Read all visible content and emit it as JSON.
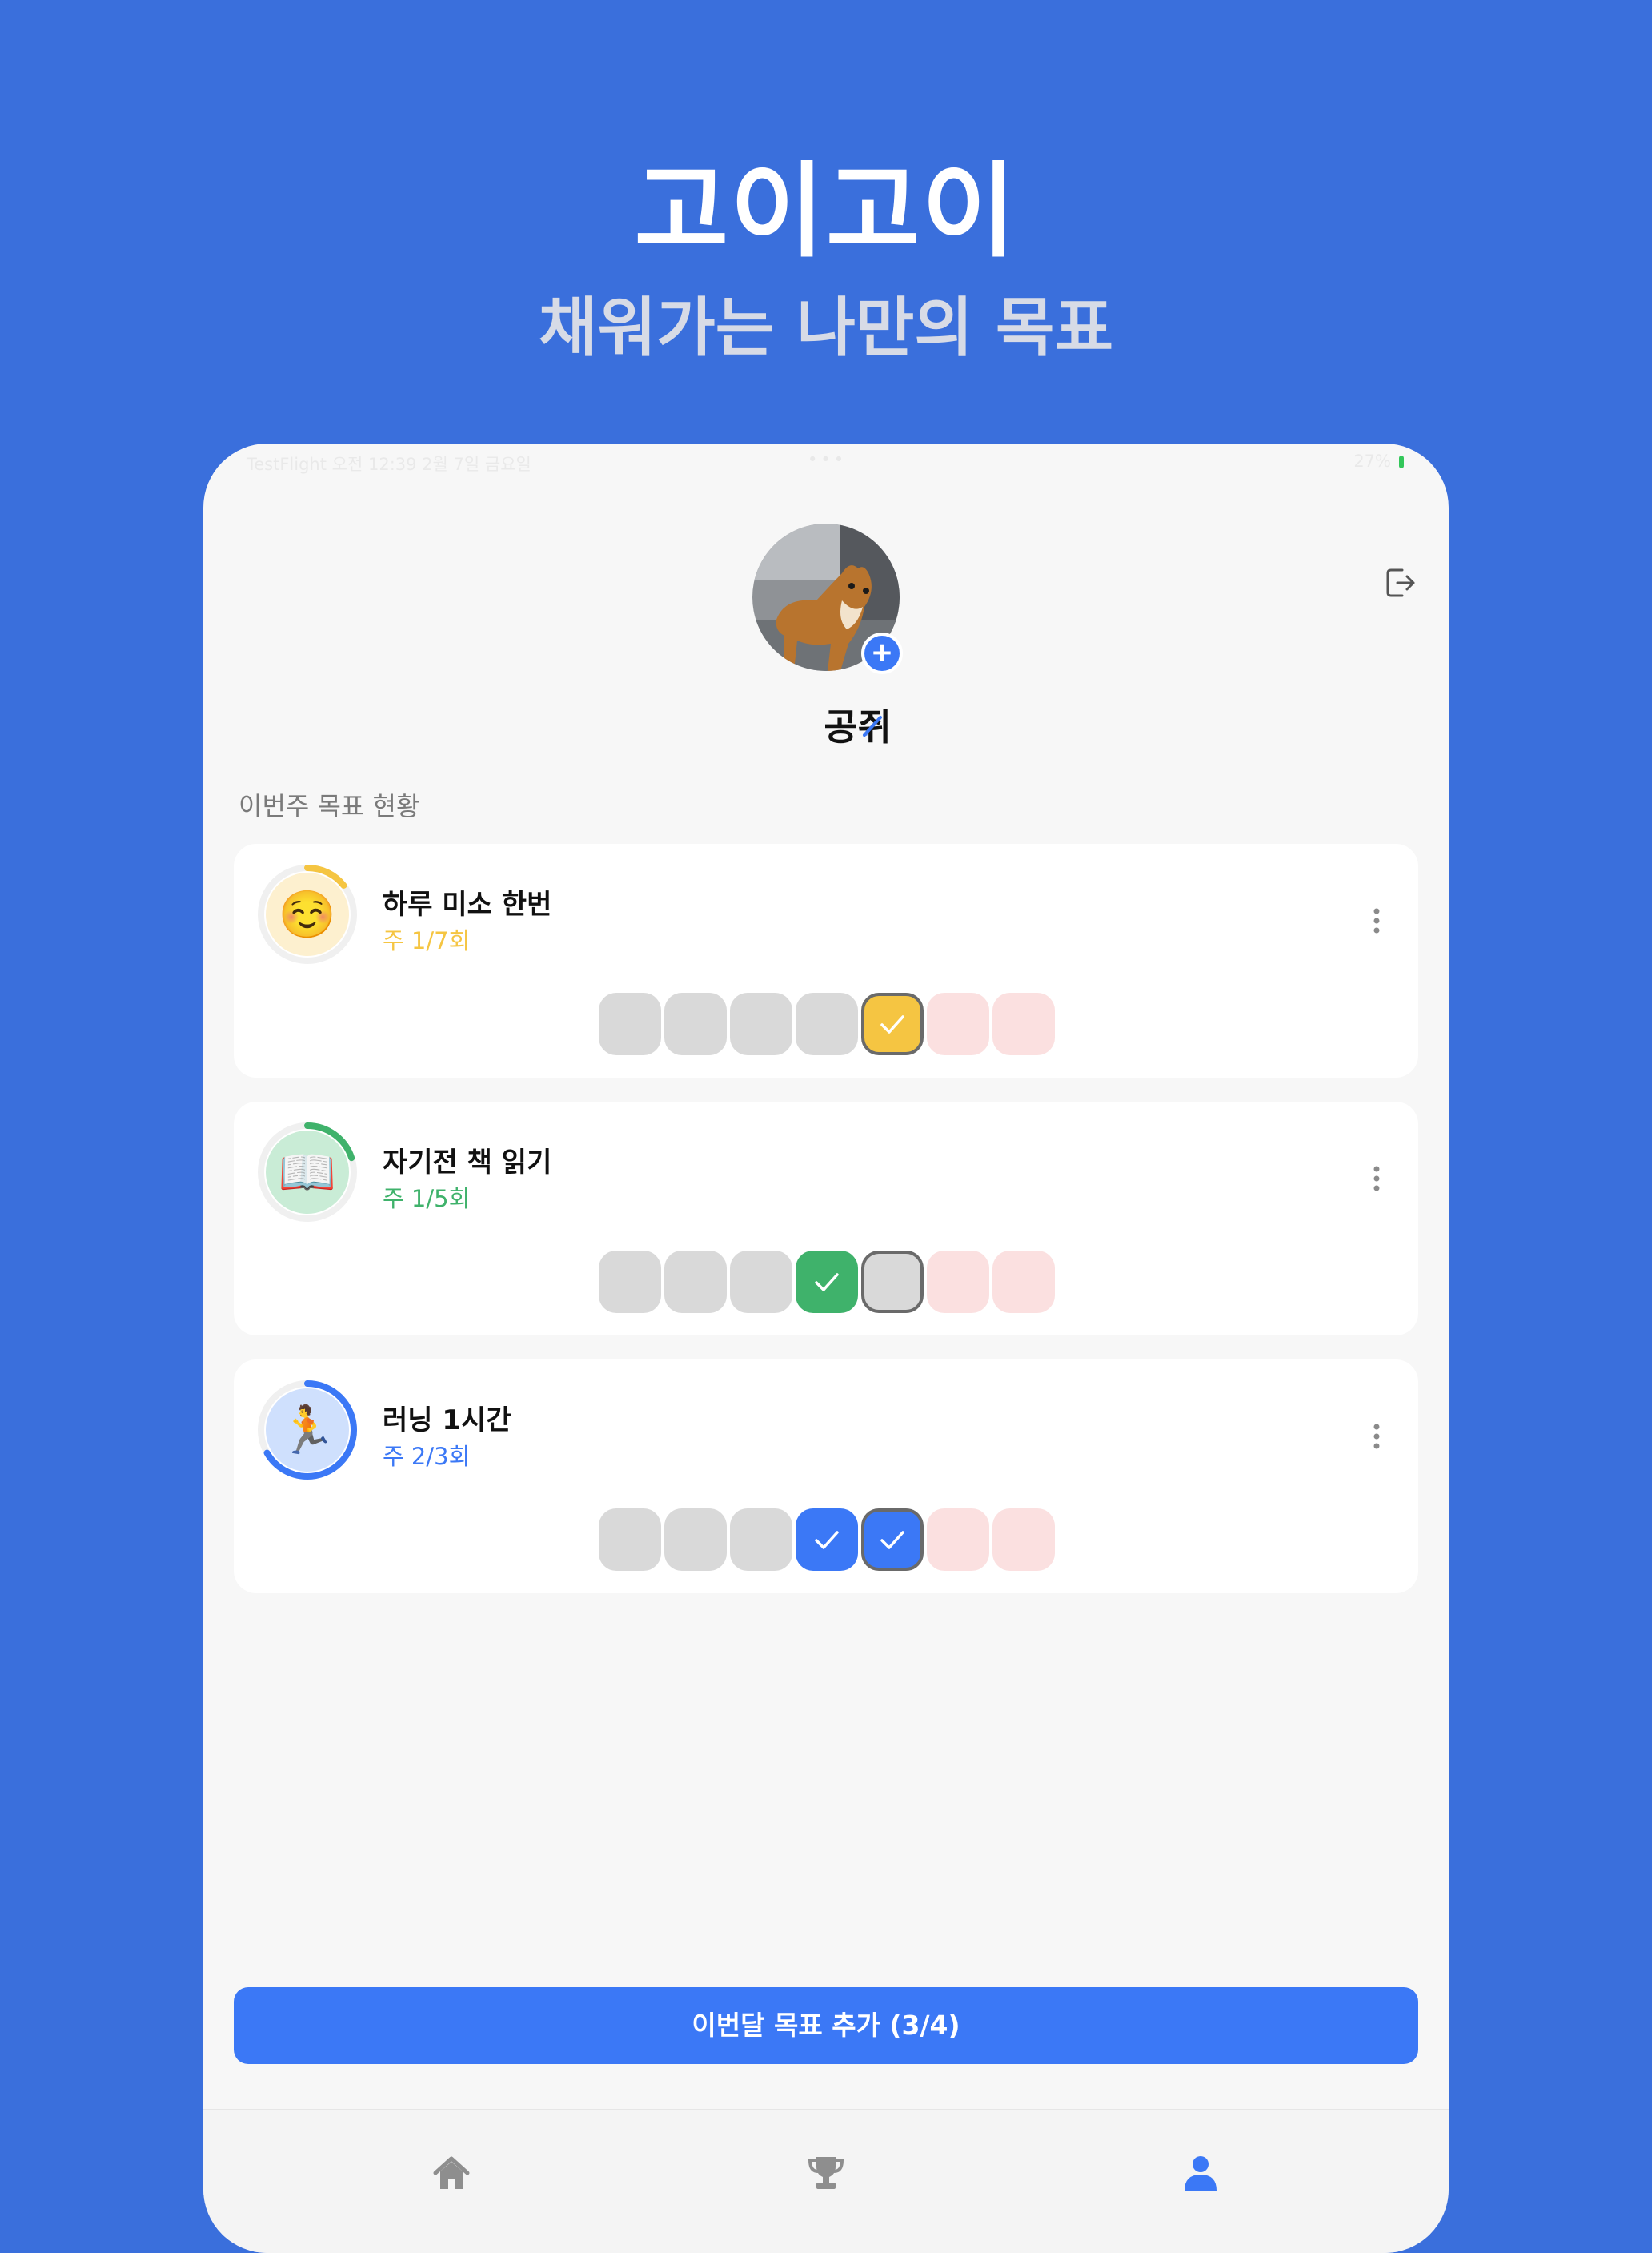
{
  "hero": {
    "title": "고이고이",
    "subtitle": "채워가는 나만의 목표"
  },
  "status_bar": {
    "left": "TestFlight  오전 12:39  2월 7일 금요일",
    "dots": "•••",
    "right": "27%"
  },
  "profile": {
    "name": "공쥐",
    "avatar_icon": "dog-photo-avatar",
    "add_icon": "plus-icon",
    "edit_icon": "pencil-icon",
    "logout_icon": "logout-icon"
  },
  "section_label": "이번주 목표 현황",
  "goals": [
    {
      "title": "하루 미소 한번",
      "count": "주 1/7회",
      "emoji": "☺️",
      "color": "#f5c542",
      "ring_bg": "#fdf0cf",
      "progress": 0.143,
      "days": [
        "empty",
        "empty",
        "empty",
        "empty",
        "today-checked",
        "future",
        "future"
      ]
    },
    {
      "title": "자기전 책 읽기",
      "count": "주 1/5회",
      "emoji": "📖",
      "color": "#3fb26b",
      "ring_bg": "#c9ecd6",
      "progress": 0.2,
      "days": [
        "empty",
        "empty",
        "empty",
        "checked",
        "today-empty",
        "future",
        "future"
      ]
    },
    {
      "title": "러닝 1시간",
      "count": "주 2/3회",
      "emoji": "🏃",
      "color": "#3b78f6",
      "ring_bg": "#cfe0fd",
      "progress": 0.667,
      "days": [
        "empty",
        "empty",
        "empty",
        "checked",
        "today-checked",
        "future",
        "future"
      ]
    }
  ],
  "add_goal_button": "이번달 목표 추가 (3/4)",
  "tabs": [
    {
      "icon": "home-icon",
      "active": false
    },
    {
      "icon": "trophy-icon",
      "active": false
    },
    {
      "icon": "person-icon",
      "active": true
    }
  ],
  "colors": {
    "background": "#3a6fdc",
    "accent": "#3b78f6",
    "day_empty": "#d9d9d9",
    "day_future": "#fbe0e0",
    "tab_inactive": "#8e8e8e"
  }
}
